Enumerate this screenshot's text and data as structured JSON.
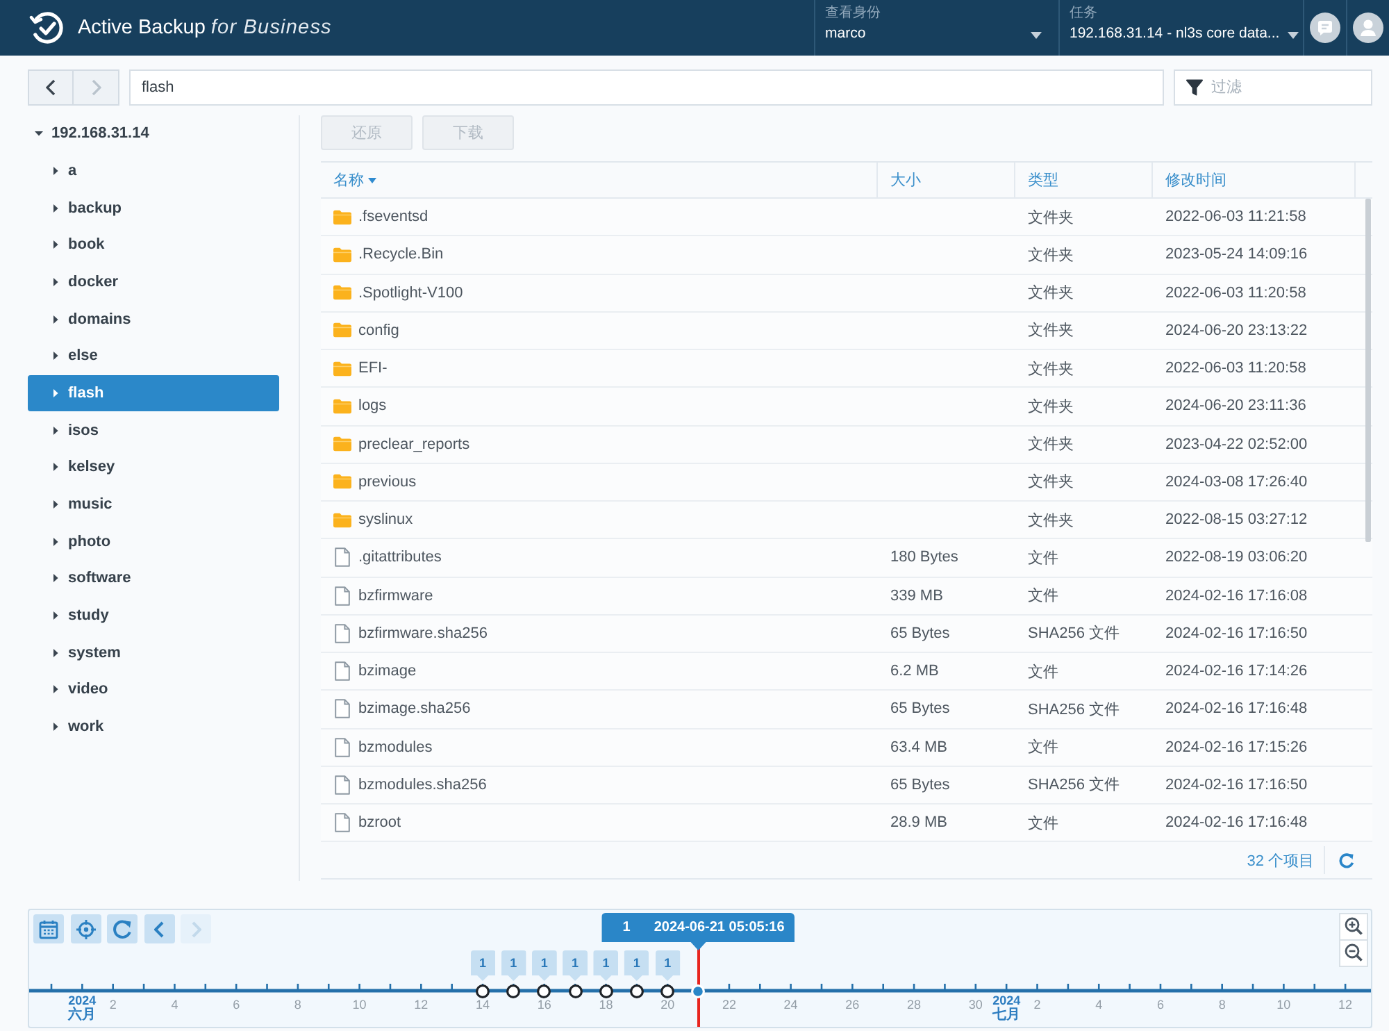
{
  "header": {
    "app_title": "Active Backup *for Business*",
    "selectors": [
      {
        "label": "查看身份",
        "value": "marco"
      },
      {
        "label": "任务",
        "value": "192.168.31.14 - nl3s core data..."
      }
    ]
  },
  "toolbar": {
    "back": {
      "disabled": false
    },
    "forward": {
      "disabled": true
    },
    "path": "flash",
    "filter": {
      "placeholder": "过滤"
    }
  },
  "tree": [
    {
      "label": "192.168.31.14",
      "expanded": true,
      "selected": false,
      "children": [
        {
          "label": "a",
          "expanded": false,
          "selected": false
        },
        {
          "label": "backup",
          "expanded": false,
          "selected": false
        },
        {
          "label": "book",
          "expanded": false,
          "selected": false
        },
        {
          "label": "docker",
          "expanded": false,
          "selected": false
        },
        {
          "label": "domains",
          "expanded": false,
          "selected": false
        },
        {
          "label": "else",
          "expanded": false,
          "selected": false
        },
        {
          "label": "flash",
          "expanded": false,
          "selected": true
        },
        {
          "label": "isos",
          "expanded": false,
          "selected": false
        },
        {
          "label": "kelsey",
          "expanded": false,
          "selected": false
        },
        {
          "label": "music",
          "expanded": false,
          "selected": false
        },
        {
          "label": "photo",
          "expanded": false,
          "selected": false
        },
        {
          "label": "software",
          "expanded": false,
          "selected": false
        },
        {
          "label": "study",
          "expanded": false,
          "selected": false
        },
        {
          "label": "system",
          "expanded": false,
          "selected": false
        },
        {
          "label": "video",
          "expanded": false,
          "selected": false
        },
        {
          "label": "work",
          "expanded": false,
          "selected": false
        }
      ]
    }
  ],
  "actions": [
    {
      "label": "还原",
      "disabled": true
    },
    {
      "label": "下载",
      "disabled": true
    }
  ],
  "table": {
    "columns": [
      {
        "label": "名称",
        "sorted": true
      },
      {
        "label": "大小",
        "sorted": false
      },
      {
        "label": "类型",
        "sorted": false
      },
      {
        "label": "修改时间",
        "sorted": false
      }
    ],
    "rows": [
      {
        "kind": "folder",
        "name": ".fseventsd",
        "type": "文件夹",
        "modified": "2022-06-03 11:21:58"
      },
      {
        "kind": "folder",
        "name": ".Recycle.Bin",
        "type": "文件夹",
        "modified": "2023-05-24 14:09:16"
      },
      {
        "kind": "folder",
        "name": ".Spotlight-V100",
        "type": "文件夹",
        "modified": "2022-06-03 11:20:58"
      },
      {
        "kind": "folder",
        "name": "config",
        "type": "文件夹",
        "modified": "2024-06-20 23:13:22"
      },
      {
        "kind": "folder",
        "name": "EFI-",
        "type": "文件夹",
        "modified": "2022-06-03 11:20:58"
      },
      {
        "kind": "folder",
        "name": "logs",
        "type": "文件夹",
        "modified": "2024-06-20 23:11:36"
      },
      {
        "kind": "folder",
        "name": "preclear_reports",
        "type": "文件夹",
        "modified": "2023-04-22 02:52:00"
      },
      {
        "kind": "folder",
        "name": "previous",
        "type": "文件夹",
        "modified": "2024-03-08 17:26:40"
      },
      {
        "kind": "folder",
        "name": "syslinux",
        "type": "文件夹",
        "modified": "2022-08-15 03:27:12"
      },
      {
        "kind": "file",
        "name": ".gitattributes",
        "size": "180 Bytes",
        "type": "文件",
        "modified": "2022-08-19 03:06:20"
      },
      {
        "kind": "file",
        "name": "bzfirmware",
        "size": "339 MB",
        "type": "文件",
        "modified": "2024-02-16 17:16:08"
      },
      {
        "kind": "file",
        "name": "bzfirmware.sha256",
        "size": "65 Bytes",
        "type": "SHA256 文件",
        "modified": "2024-02-16 17:16:50"
      },
      {
        "kind": "file",
        "name": "bzimage",
        "size": "6.2 MB",
        "type": "文件",
        "modified": "2024-02-16 17:14:26"
      },
      {
        "kind": "file",
        "name": "bzimage.sha256",
        "size": "65 Bytes",
        "type": "SHA256 文件",
        "modified": "2024-02-16 17:16:48"
      },
      {
        "kind": "file",
        "name": "bzmodules",
        "size": "63.4 MB",
        "type": "文件",
        "modified": "2024-02-16 17:15:26"
      },
      {
        "kind": "file",
        "name": "bzmodules.sha256",
        "size": "65 Bytes",
        "type": "SHA256 文件",
        "modified": "2024-02-16 17:16:50"
      },
      {
        "kind": "file",
        "name": "bzroot",
        "size": "28.9 MB",
        "type": "文件",
        "modified": "2024-02-16 17:16:48"
      }
    ],
    "footer": {
      "count": "32 个项目"
    }
  },
  "timeline": {
    "buttons": [
      {
        "kind": "calendar",
        "disabled": false
      },
      {
        "kind": "locate",
        "disabled": false
      },
      {
        "kind": "refresh",
        "disabled": false
      },
      {
        "kind": "prev",
        "disabled": false
      },
      {
        "kind": "next",
        "disabled": true
      }
    ],
    "cursor": {
      "count": "1",
      "time": "2024-06-21 05:05:16"
    },
    "snapshots": [
      {
        "count": "1",
        "selected": false
      },
      {
        "count": "1",
        "selected": false
      },
      {
        "count": "1",
        "selected": false
      },
      {
        "count": "1",
        "selected": false
      },
      {
        "count": "1",
        "selected": false
      },
      {
        "count": "1",
        "selected": false
      },
      {
        "count": "1",
        "selected": false
      },
      {
        "selected": true
      }
    ],
    "axis_labels": [
      {
        "kind": "month",
        "year": "2024",
        "month": "六月"
      },
      {
        "kind": "day",
        "label": "2"
      },
      {
        "kind": "day",
        "label": "4"
      },
      {
        "kind": "day",
        "label": "6"
      },
      {
        "kind": "day",
        "label": "8"
      },
      {
        "kind": "day",
        "label": "10"
      },
      {
        "kind": "day",
        "label": "12"
      },
      {
        "kind": "day",
        "label": "14"
      },
      {
        "kind": "day",
        "label": "16"
      },
      {
        "kind": "day",
        "label": "18"
      },
      {
        "kind": "day",
        "label": "20"
      },
      {
        "kind": "day",
        "label": "22"
      },
      {
        "kind": "day",
        "label": "24"
      },
      {
        "kind": "day",
        "label": "26"
      },
      {
        "kind": "day",
        "label": "28"
      },
      {
        "kind": "day",
        "label": "30"
      },
      {
        "kind": "month",
        "year": "2024",
        "month": "七月"
      },
      {
        "kind": "day",
        "label": "2"
      },
      {
        "kind": "day",
        "label": "4"
      },
      {
        "kind": "day",
        "label": "6"
      },
      {
        "kind": "day",
        "label": "8"
      },
      {
        "kind": "day",
        "label": "10"
      },
      {
        "kind": "day",
        "label": "12"
      }
    ]
  }
}
